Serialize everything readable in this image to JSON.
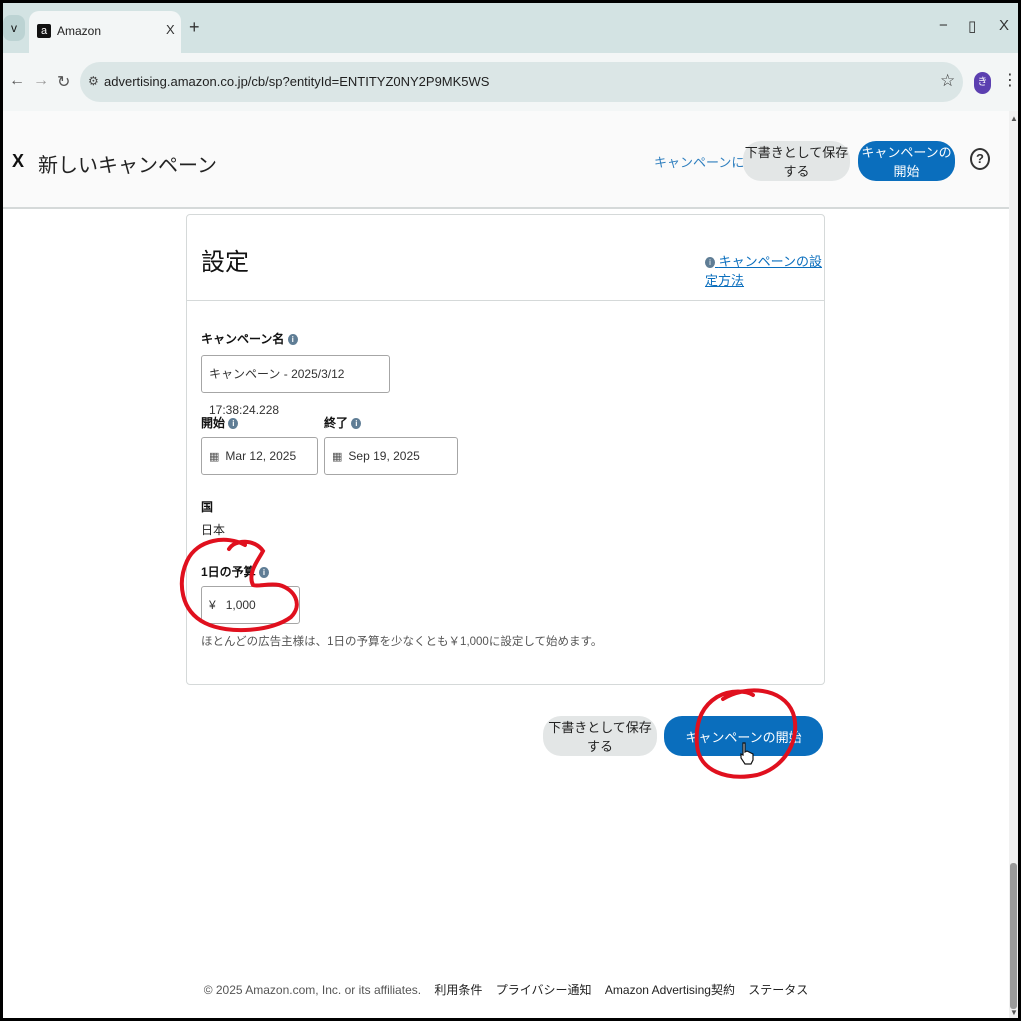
{
  "browser": {
    "tab_title": "Amazon",
    "tab_list_glyph": "v",
    "favicon_glyph": "a",
    "tab_close_glyph": "X",
    "new_tab_glyph": "+",
    "minimize_glyph": "−",
    "restore_glyph": "▯",
    "close_glyph": "X",
    "url": "advertising.amazon.co.jp/cb/sp?entityId=ENTITYZ0NY2P9MK5WS",
    "profile_initial": "き"
  },
  "header": {
    "title": "新しいキャンペーン",
    "back_link": "キャンペーンに戻る",
    "save_draft": "下書きとして保存する",
    "launch": "キャンペーンの開始",
    "help_glyph": "?"
  },
  "settings": {
    "title": "設定",
    "guide_link": "キャンペーンの設定方法",
    "campaign_name_label": "キャンペーン名",
    "campaign_name_value": "キャンペーン - 2025/3/12 17:38:24.228",
    "start_label": "開始",
    "start_value": "Mar 12, 2025",
    "end_label": "終了",
    "end_value": "Sep 19, 2025",
    "country_label": "国",
    "country_value": "日本",
    "budget_label": "1日の予算",
    "budget_currency": "¥",
    "budget_value": "1,000",
    "budget_hint": "ほとんどの広告主様は、1日の予算を少なくとも￥1,000に設定して始めます。"
  },
  "actions": {
    "save_draft": "下書きとして保存する",
    "launch": "キャンペーンの開始"
  },
  "footer": {
    "copyright": "© 2025 Amazon.com, Inc. or its affiliates.",
    "links": [
      "利用条件",
      "プライバシー通知",
      "Amazon Advertising契約",
      "ステータス"
    ]
  },
  "colors": {
    "primary": "#0a6ebd",
    "annotation": "#e0101e"
  },
  "icons": {
    "nav": [
      "back-arrow-icon",
      "forward-arrow-icon",
      "reload-icon"
    ],
    "info": "info-icon",
    "calendar": "calendar-icon",
    "cursor": "hand-cursor-icon"
  }
}
